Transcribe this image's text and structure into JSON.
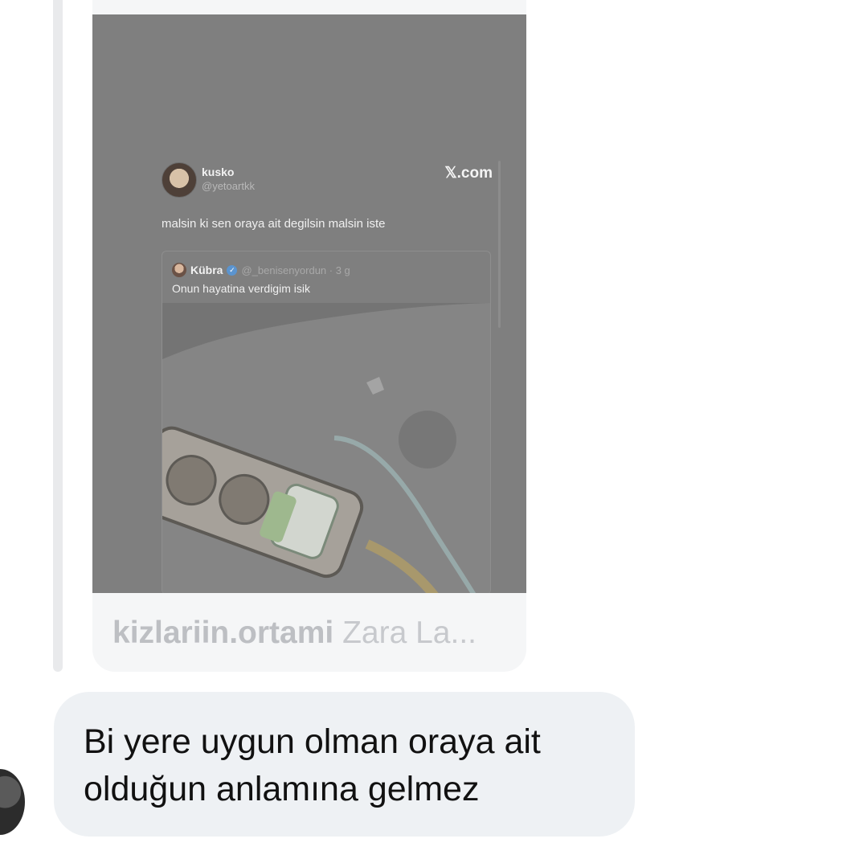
{
  "shared_post": {
    "account": "kizlariin.ortami",
    "title": "Zara La...",
    "screenshot": {
      "tweet": {
        "name": "kusko",
        "handle": "@yetoartkk",
        "site": "𝕏.com",
        "text": "malsin ki sen oraya ait degilsin malsin iste",
        "quote": {
          "name": "Kübra",
          "handle_time": "@_benisenyordun · 3 g",
          "text": "Onun hayatina verdigim isik"
        }
      }
    }
  },
  "message": {
    "text": "Bi yere uygun olman oraya ait olduğun anlamına gelmez"
  },
  "icons": {
    "verified": "verified-badge-icon"
  },
  "colors": {
    "bubble": "#eef1f4",
    "card": "#f5f6f7",
    "verified": "#5b94cf"
  }
}
